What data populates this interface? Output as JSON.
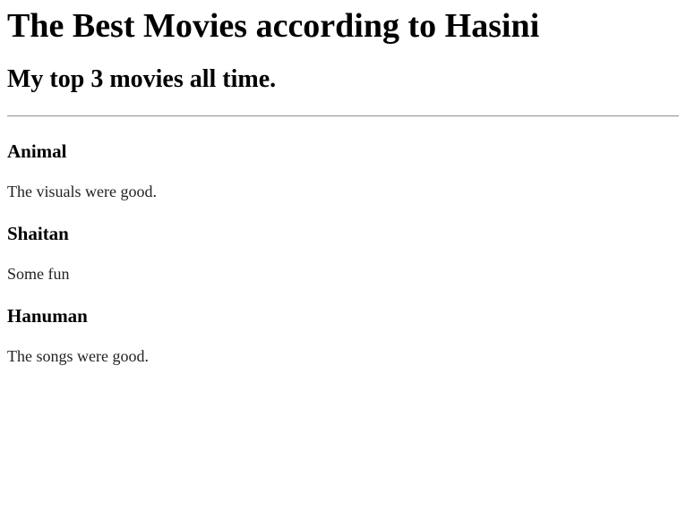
{
  "page": {
    "title": "The Best Movies according to Hasini",
    "subtitle": "My top 3 movies all time."
  },
  "movies": [
    {
      "name": "Animal",
      "review": "The visuals were good."
    },
    {
      "name": "Shaitan",
      "review": "Some fun"
    },
    {
      "name": "Hanuman",
      "review": "The songs were good."
    }
  ]
}
